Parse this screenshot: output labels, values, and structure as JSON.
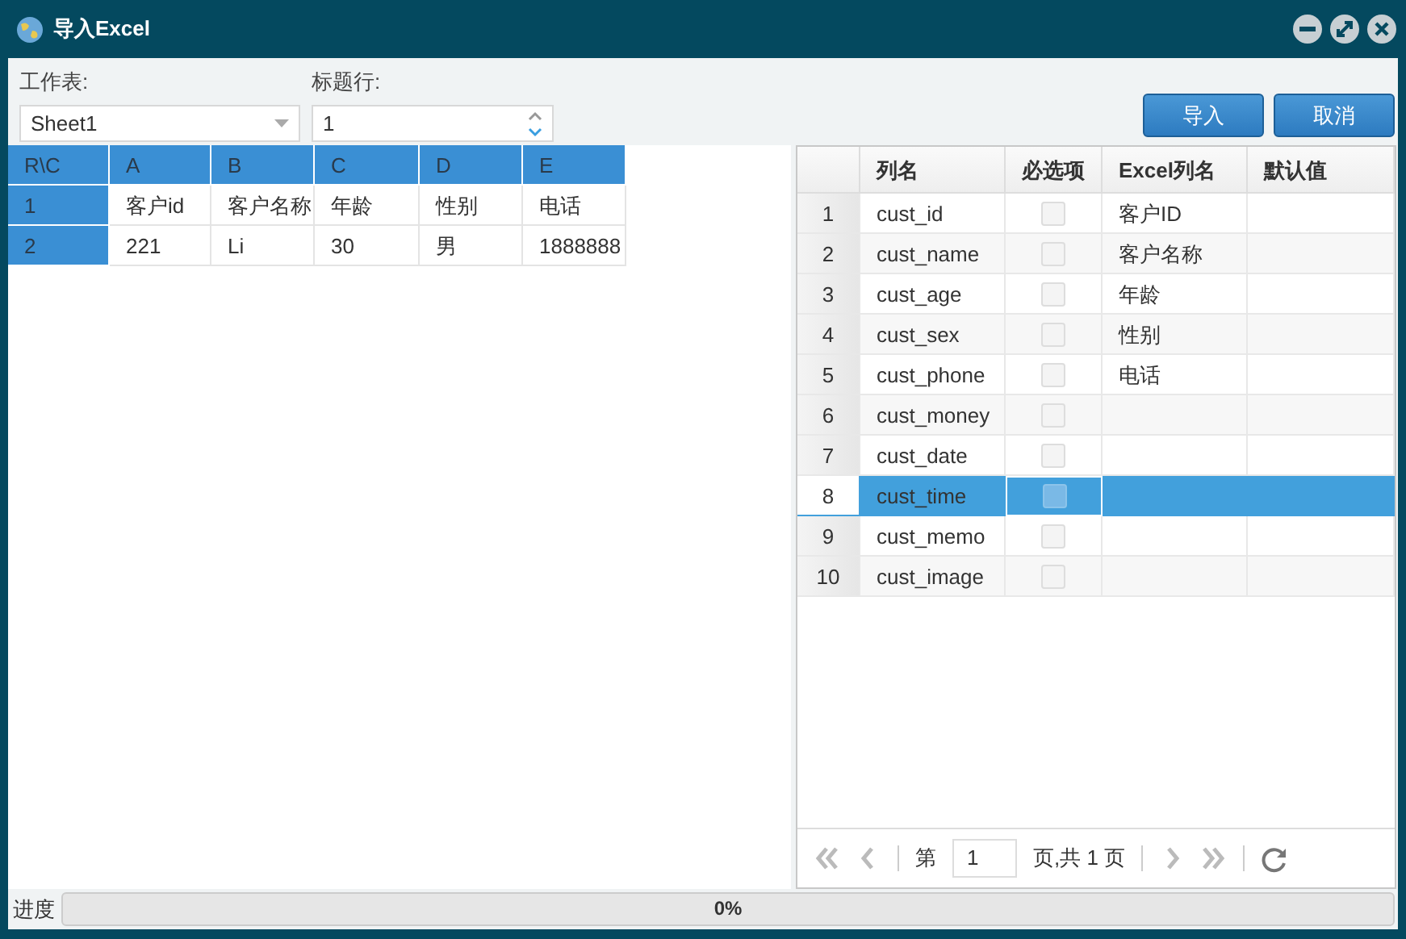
{
  "window": {
    "title": "导入Excel"
  },
  "sheet": {
    "label": "工作表:",
    "value": "Sheet1"
  },
  "header_row": {
    "label": "标题行:",
    "value": "1"
  },
  "buttons": [
    "导入",
    "取消"
  ],
  "preview": {
    "columns": [
      "R\\C",
      "A",
      "B",
      "C",
      "D",
      "E"
    ],
    "rows": [
      {
        "cells": [
          "1",
          "客户id",
          "客户名称",
          "年龄",
          "性别",
          "电话"
        ]
      },
      {
        "cells": [
          "2",
          "221",
          "Li",
          "30",
          "男",
          "1888888"
        ]
      }
    ]
  },
  "mapping": {
    "columns": [
      "列名",
      "必选项",
      "Excel列名",
      "默认值"
    ],
    "rows": [
      {
        "num": "1",
        "name": "cust_id",
        "required": false,
        "excel": "客户ID",
        "selected": false
      },
      {
        "num": "2",
        "name": "cust_name",
        "required": false,
        "excel": "客户名称",
        "selected": false
      },
      {
        "num": "3",
        "name": "cust_age",
        "required": false,
        "excel": "年龄",
        "selected": false
      },
      {
        "num": "4",
        "name": "cust_sex",
        "required": false,
        "excel": "性别",
        "selected": false
      },
      {
        "num": "5",
        "name": "cust_phone",
        "required": false,
        "excel": "电话",
        "selected": false
      },
      {
        "num": "6",
        "name": "cust_money",
        "required": false,
        "selected": false
      },
      {
        "num": "7",
        "name": "cust_date",
        "required": false,
        "selected": false
      },
      {
        "num": "8",
        "name": "cust_time",
        "required": false,
        "selected": true
      },
      {
        "num": "9",
        "name": "cust_memo",
        "required": false,
        "selected": false
      },
      {
        "num": "10",
        "name": "cust_image",
        "required": false,
        "selected": false
      }
    ]
  },
  "pager": {
    "before": "第",
    "page": "1",
    "after": "页,共 1 页"
  },
  "progress": {
    "label": "进度",
    "level": 0,
    "reading": "0%"
  }
}
